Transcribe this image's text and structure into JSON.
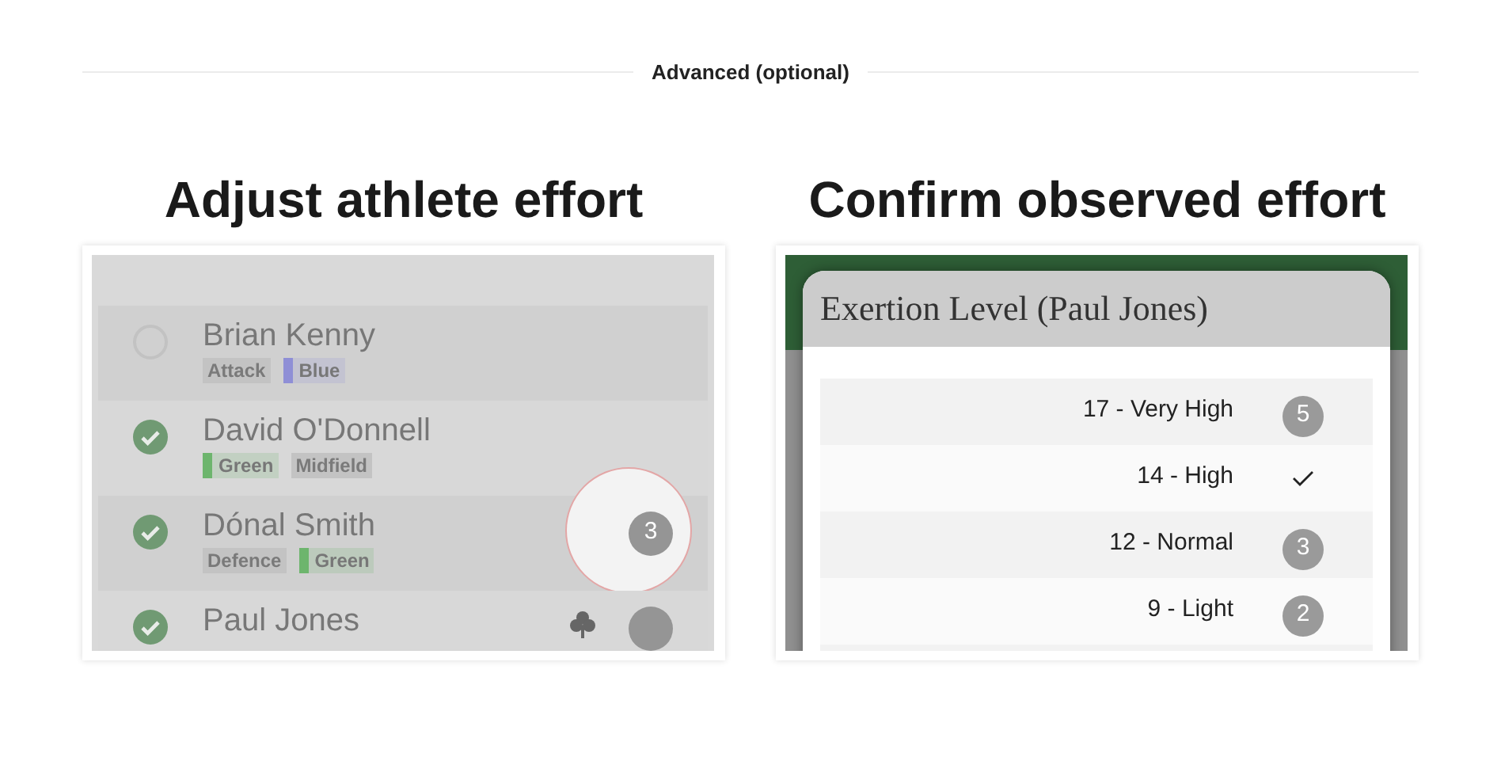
{
  "divider": {
    "label": "Advanced (optional)"
  },
  "panels": [
    {
      "kind": "athletes",
      "title": "Adjust athlete effort",
      "athletes": [
        {
          "name": "Brian Kenny",
          "checked": false,
          "tags": [
            {
              "label": "Attack"
            },
            {
              "label": "Blue",
              "color": "#8f8fd6"
            }
          ]
        },
        {
          "name": "David O'Donnell",
          "checked": true,
          "tags": [
            {
              "label": "Green",
              "color": "#6db56d"
            },
            {
              "label": "Midfield"
            }
          ]
        },
        {
          "name": "Dónal Smith",
          "checked": true,
          "tags": [
            {
              "label": "Defence"
            },
            {
              "label": "Green",
              "color": "#6db56d"
            }
          ],
          "badge": "3",
          "highlighted": true
        },
        {
          "name": "Paul Jones",
          "checked": true,
          "flagged": true,
          "badge_partial": true
        }
      ]
    },
    {
      "kind": "exertion",
      "title": "Confirm observed effort",
      "dialog_title": "Exertion Level (Paul Jones)",
      "options": [
        {
          "label": "17 - Very High",
          "badge": "5",
          "selected": false
        },
        {
          "label": "14 - High",
          "selected": true
        },
        {
          "label": "12 - Normal",
          "badge": "3",
          "selected": false
        },
        {
          "label": "9 - Light",
          "badge": "2",
          "selected": false
        }
      ]
    }
  ]
}
